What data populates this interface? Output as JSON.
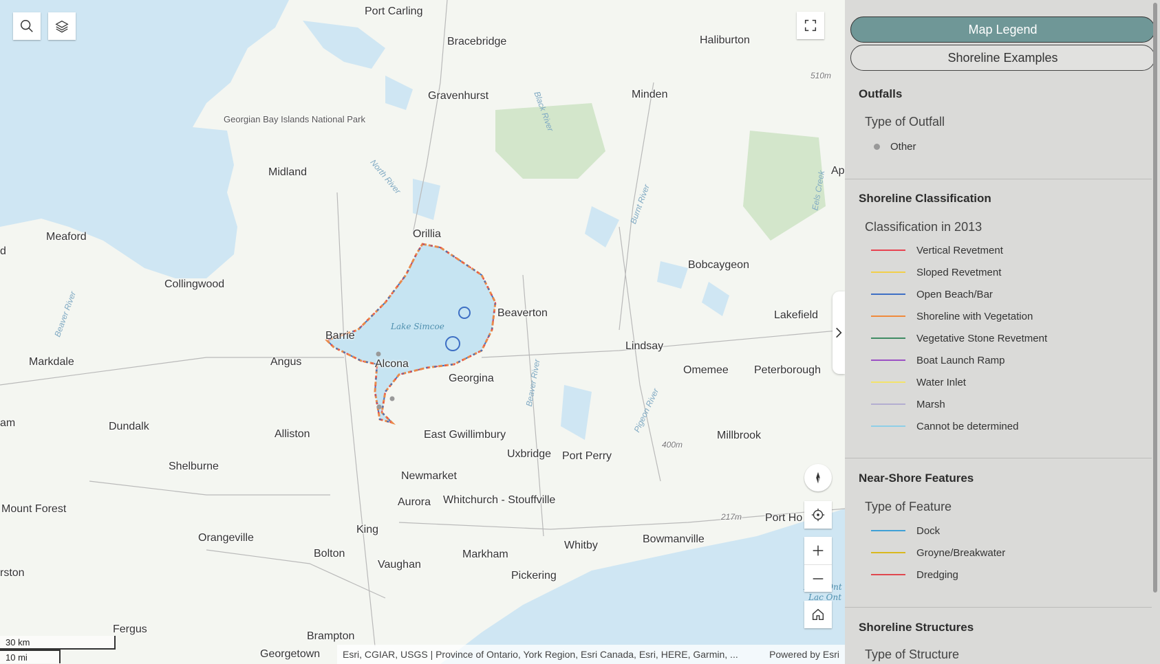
{
  "map": {
    "places": [
      {
        "name": "Port Carling"
      },
      {
        "name": "Bracebridge"
      },
      {
        "name": "Haliburton"
      },
      {
        "name": "Gravenhurst"
      },
      {
        "name": "Minden"
      },
      {
        "name": "Midland"
      },
      {
        "name": "Meaford"
      },
      {
        "name": "Orillia"
      },
      {
        "name": "Collingwood"
      },
      {
        "name": "Bobcaygeon"
      },
      {
        "name": "Beaverton"
      },
      {
        "name": "Lakefield"
      },
      {
        "name": "Barrie"
      },
      {
        "name": "Lindsay"
      },
      {
        "name": "Markdale"
      },
      {
        "name": "Angus"
      },
      {
        "name": "Alcona"
      },
      {
        "name": "Omemee"
      },
      {
        "name": "Peterborough"
      },
      {
        "name": "Georgina"
      },
      {
        "name": "Dundalk"
      },
      {
        "name": "Alliston"
      },
      {
        "name": "East Gwillimbury"
      },
      {
        "name": "Millbrook"
      },
      {
        "name": "Shelburne"
      },
      {
        "name": "Uxbridge"
      },
      {
        "name": "Port Perry"
      },
      {
        "name": "Newmarket"
      },
      {
        "name": "Mount Forest"
      },
      {
        "name": "Aurora"
      },
      {
        "name": "Whitchurch - Stouffville"
      },
      {
        "name": "Port Ho"
      },
      {
        "name": "King"
      },
      {
        "name": "Orangeville"
      },
      {
        "name": "Bowmanville"
      },
      {
        "name": "Whitby"
      },
      {
        "name": "Bolton"
      },
      {
        "name": "Markham"
      },
      {
        "name": "Vaughan"
      },
      {
        "name": "Pickering"
      },
      {
        "name": "rston"
      },
      {
        "name": "Fergus"
      },
      {
        "name": "Brampton"
      },
      {
        "name": "Georgetown"
      },
      {
        "name": "am"
      },
      {
        "name": "d"
      },
      {
        "name": "Ap"
      }
    ],
    "park_label": "Georgian Bay Islands National Park",
    "lake_label": "Lake Simcoe",
    "rivers": [
      "North River",
      "Black River",
      "Burnt River",
      "Eels Creek",
      "Beaver River",
      "Beaver River",
      "Pigeon River"
    ],
    "elevations": [
      "510m",
      "400m",
      "217m"
    ],
    "lake_ontario_fr": "Lac Ont",
    "lake_ontario_en": "Lake Ont",
    "scale_km": "30 km",
    "scale_mi": "10 mi",
    "attribution": "Esri, CGIAR, USGS | Province of Ontario, York Region, Esri Canada, Esri, HERE, Garmin, ...",
    "powered_by": "Powered by Esri",
    "controls": {
      "search_icon": "search-icon",
      "layers_icon": "layers-icon",
      "fullscreen_icon": "fullscreen-icon",
      "compass_icon": "compass-icon",
      "locate_icon": "locate-icon",
      "zoom_in": "+",
      "zoom_out": "—",
      "home_icon": "home-icon"
    }
  },
  "panel": {
    "tabs": [
      "Map Legend",
      "Shoreline Examples"
    ],
    "active_tab": "Map Legend",
    "sections": [
      {
        "title": "Outfalls",
        "subtitle": "Type of Outfall",
        "items": [
          {
            "label": "Other",
            "type": "dot",
            "color": "#9a9a9a"
          }
        ]
      },
      {
        "title": "Shoreline Classification",
        "subtitle": "Classification in 2013",
        "items": [
          {
            "label": "Vertical Revetment",
            "color": "#e8414f"
          },
          {
            "label": "Sloped Revetment",
            "color": "#f2cf4a"
          },
          {
            "label": "Open Beach/Bar",
            "color": "#3d6fc4"
          },
          {
            "label": "Shoreline with Vegetation",
            "color": "#f08a3c"
          },
          {
            "label": "Vegetative Stone Revetment",
            "color": "#3f8c63"
          },
          {
            "label": "Boat Launch Ramp",
            "color": "#9b4fc4"
          },
          {
            "label": "Water Inlet",
            "color": "#f3e36a"
          },
          {
            "label": "Marsh",
            "color": "#b3aed0"
          },
          {
            "label": "Cannot be determined",
            "color": "#8ecfe8"
          }
        ]
      },
      {
        "title": "Near-Shore Features",
        "subtitle": "Type of Feature",
        "items": [
          {
            "label": "Dock",
            "color": "#3fa0d6"
          },
          {
            "label": "Groyne/Breakwater",
            "color": "#d9b81e"
          },
          {
            "label": "Dredging",
            "color": "#e0474e"
          }
        ]
      },
      {
        "title": "Shoreline Structures",
        "subtitle": "Type of Structure",
        "items": []
      }
    ]
  }
}
